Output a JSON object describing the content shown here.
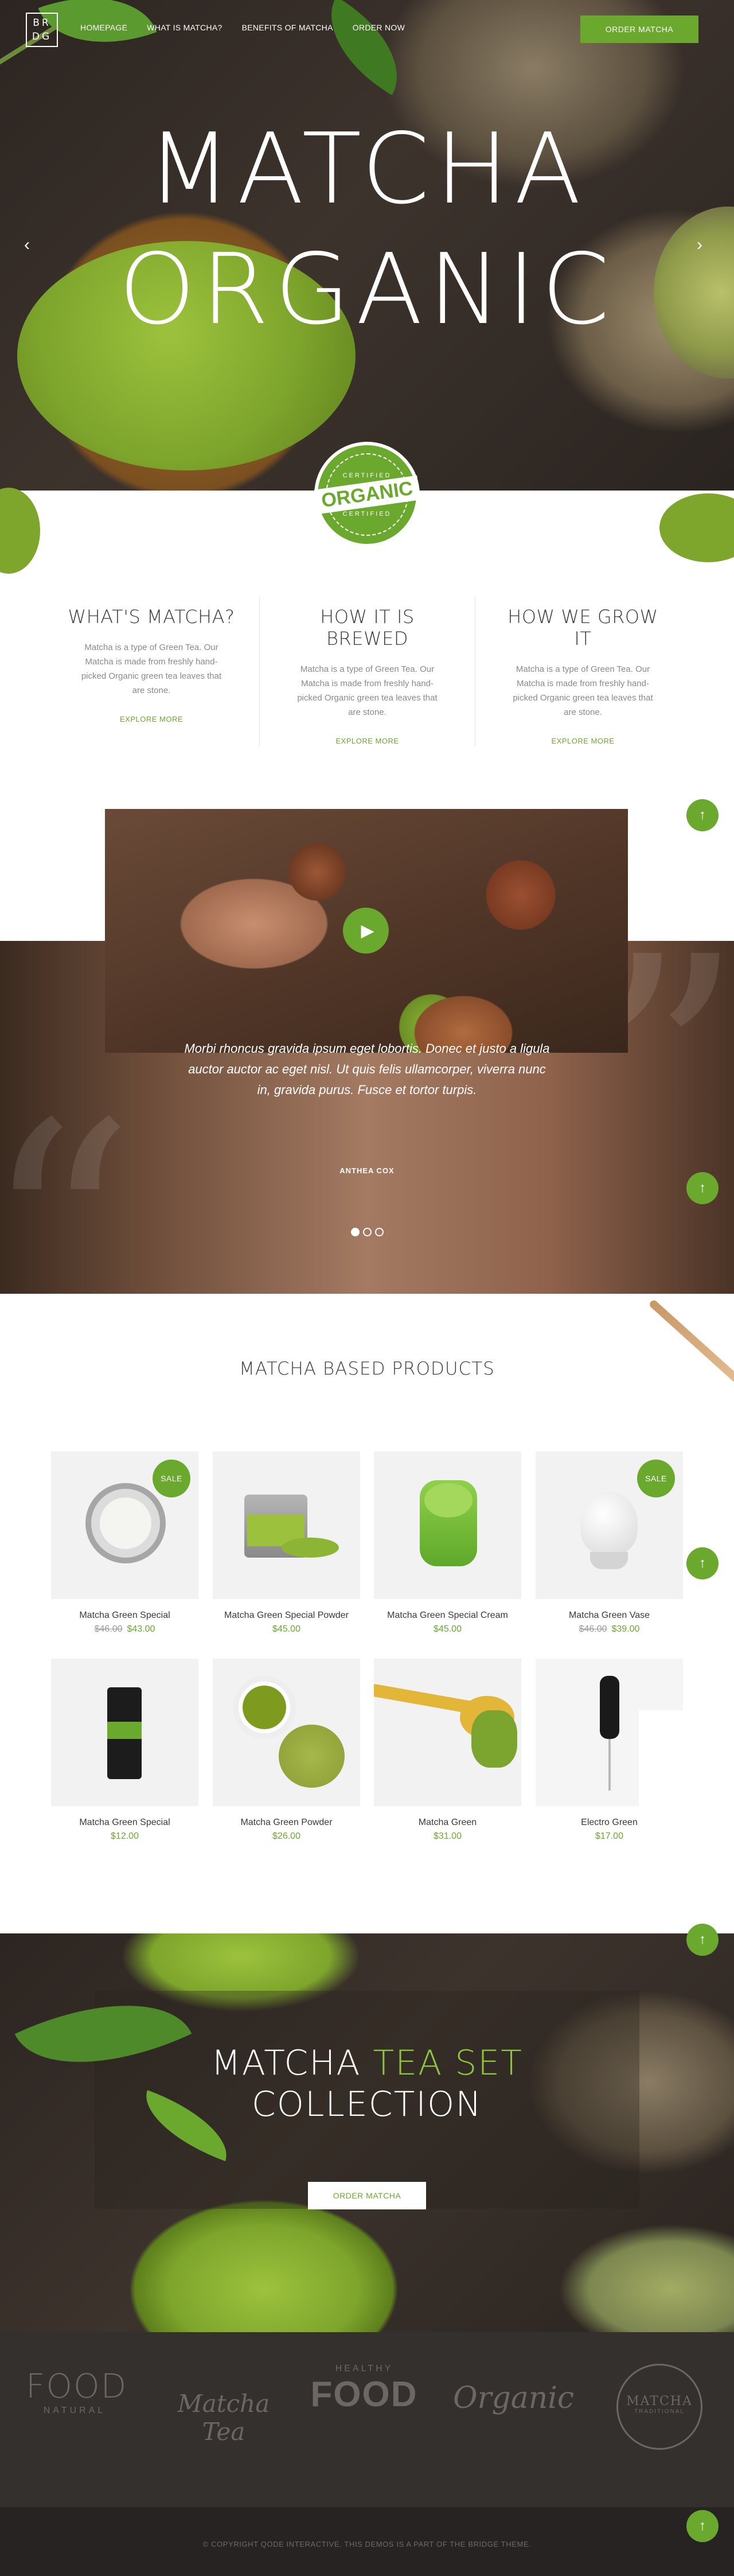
{
  "brand": {
    "logo_line1": "BR",
    "logo_line2": "DG"
  },
  "nav": {
    "items": [
      "HOMEPAGE",
      "WHAT IS MATCHA?",
      "BENEFITS OF MATCHA",
      "ORDER NOW"
    ],
    "cta": "ORDER MATCHA"
  },
  "hero": {
    "title_line1": "MATCHA",
    "title_line2": "ORGANIC",
    "prev_icon": "chevron-left-icon",
    "next_icon": "chevron-right-icon"
  },
  "badge": {
    "top": "CERTIFIED",
    "middle": "ORGANIC",
    "bottom": "CERTIFIED"
  },
  "features": [
    {
      "title": "WHAT'S MATCHA?",
      "text": "Matcha is a type of Green Tea. Our Matcha is made from freshly hand-picked Organic green tea leaves that are stone.",
      "link": "EXPLORE MORE"
    },
    {
      "title": "HOW IT IS BREWED",
      "text": "Matcha is a type of Green Tea. Our Matcha is made from freshly hand-picked Organic green tea leaves that are stone.",
      "link": "EXPLORE MORE"
    },
    {
      "title": "HOW WE GROW IT",
      "text": "Matcha is a type of Green Tea. Our Matcha is made from freshly hand-picked Organic green tea leaves that are stone.",
      "link": "EXPLORE MORE"
    }
  ],
  "testimonial": {
    "quote": "Morbi rhoncus gravida ipsum eget lobortis. Donec et justo a ligula auctor auctor ac eget nisl. Ut quis felis ullamcorper, viverra nunc in, gravida purus. Fusce et tortor turpis.",
    "author": "ANTHEA COX",
    "slides": 3,
    "active_slide": 1
  },
  "products": {
    "title": "MATCHA BASED PRODUCTS",
    "sale_label": "SALE",
    "items": [
      {
        "name": "Matcha Green Special",
        "old_price": "$46.00",
        "price": "$43.00",
        "sale": true
      },
      {
        "name": "Matcha Green Special Powder",
        "old_price": "",
        "price": "$45.00",
        "sale": false
      },
      {
        "name": "Matcha Green Special Cream",
        "old_price": "",
        "price": "$45.00",
        "sale": false
      },
      {
        "name": "Matcha Green Vase",
        "old_price": "$46.00",
        "price": "$39.00",
        "sale": true
      },
      {
        "name": "Matcha Green Special",
        "old_price": "",
        "price": "$12.00",
        "sale": false
      },
      {
        "name": "Matcha Green Powder",
        "old_price": "",
        "price": "$26.00",
        "sale": false
      },
      {
        "name": "Matcha Green",
        "old_price": "",
        "price": "$31.00",
        "sale": false
      },
      {
        "name": "Electro Green",
        "old_price": "",
        "price": "$17.00",
        "sale": false
      }
    ]
  },
  "collection": {
    "title_white": "MATCHA",
    "title_accent": "TEA SET",
    "title_line2": "COLLECTION",
    "button": "ORDER MATCHA"
  },
  "logos": {
    "food": {
      "big": "FOOD",
      "small": "NATURAL"
    },
    "matcha_tea": "Matcha Tea",
    "healthy_food": {
      "small": "HEALTHY",
      "big": "FOOD"
    },
    "organic": "Organic",
    "matcha_traditional": {
      "big": "MATCHA",
      "small": "TRADITIONAL"
    }
  },
  "footer": {
    "copyright": "© COPYRIGHT QODE INTERACTIVE. THIS DEMOS IS A PART OF THE BRIDGE THEME."
  },
  "colors": {
    "accent": "#6aa82e",
    "dark": "#262322",
    "logo_bar": "#34302d"
  },
  "icons": {
    "scroll_top": "arrow-up-icon",
    "play": "play-icon"
  }
}
